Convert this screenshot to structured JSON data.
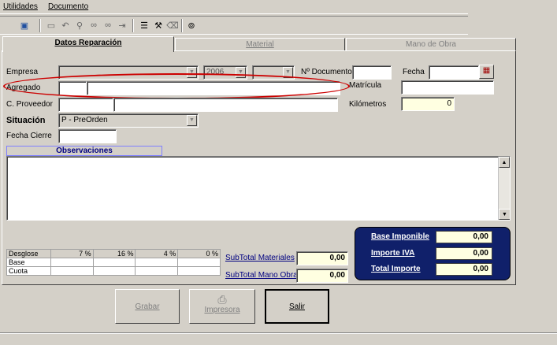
{
  "menu": {
    "items": [
      "Utilidades",
      "Documento"
    ]
  },
  "tabs": [
    "Datos Reparación",
    "Material",
    "Mano de Obra"
  ],
  "form": {
    "empresa_label": "Empresa",
    "year_value": "2006",
    "ndoc_label": "Nº Documento",
    "fecha_label": "Fecha",
    "agregado_label": "Agregado",
    "matricula_label": "Matrícula",
    "proveedor_label": "C. Proveedor",
    "kilometros_label": "Kilómetros",
    "kilometros_value": "0",
    "situacion_label": "Situación",
    "situacion_value": "P - PreOrden",
    "fecha_cierre_label": "Fecha Cierre",
    "observaciones_label": "Observaciones"
  },
  "desglose": {
    "headers": [
      "Desglose",
      "7 %",
      "16 %",
      "4 %",
      "0 %"
    ],
    "rows": [
      "Base",
      "Cuota"
    ]
  },
  "subtotals": {
    "materiales_label": "SubTotal Materiales",
    "materiales_value": "0,00",
    "mano_obra_label": "SubTotal Mano Obra",
    "mano_obra_value": "0,00"
  },
  "totals": {
    "base_label": "Base Imponible",
    "base_value": "0,00",
    "iva_label": "Importe IVA",
    "iva_value": "0,00",
    "total_label": "Total Importe",
    "total_value": "0,00"
  },
  "buttons": {
    "grabar": "Grabar",
    "impresora": "Impresora",
    "salir": "Salir"
  },
  "colors": {
    "totals_bg": "#10206a",
    "highlight_ellipse": "#cc0000",
    "readonly_yellow": "#ffffe1"
  }
}
